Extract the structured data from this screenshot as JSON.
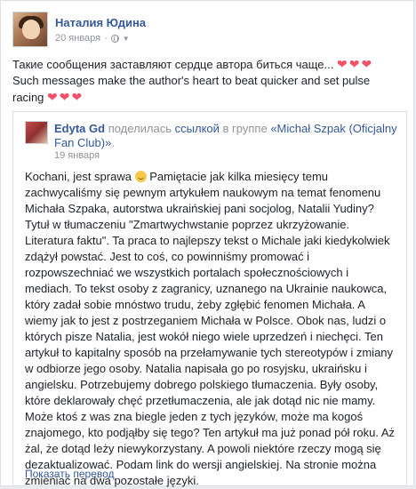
{
  "post": {
    "author": "Наталия Юдина",
    "date": "20 января",
    "text_ru": "Такие сообщения заставляют сердце автора биться чаще...",
    "text_en": "Such messages make the author's heart to beat quicker and set pulse racing",
    "hearts": "❤❤❤"
  },
  "shared": {
    "author": "Edyta Gd",
    "action": "поделилась",
    "link": "ссылкой",
    "in_group": "в группе",
    "group": "«Michał Szpak (Oficjalny Fan Club)»",
    "period": ".",
    "date": "19 января",
    "body_pre": "Kochani, jest sprawa ",
    "body_post": " Pamiętacie jak kilka miesięcy temu zachwycaliśmy się pewnym artykułem naukowym na temat fenomenu Michała Szpaka, autorstwa ukraińskiej pani socjolog, Natalii Yudiny? Tytuł w tłumaczeniu \"Zmartwychwstanie poprzez ukrzyżowanie. Literatura faktu\". Ta praca to najlepszy tekst o Michale jaki kiedykolwiek zdążył powstać. Jest to coś, co powinniśmy promować i rozpowszechniać we wszystkich portalach społecznościowych i mediach. To tekst osoby z zagranicy, uznanego na Ukrainie naukowca, który zadał sobie mnóstwo trudu, żeby zgłębić fenomen Michała. A wiemy jak to jest z postrzeganiem Michała w Polsce. Obok nas, ludzi o których pisze Natalia, jest wokół niego wiele uprzedzeń i niechęci. Ten artykuł to kapitalny sposób na przełamywanie tych stereotypów i zmiany w odbiorze jego osoby. Natalia napisała go po rosyjsku, ukraińsku i angielsku. Potrzebujemy dobrego polskiego tłumaczenia. Były osoby, które deklarowały chęć przetłumaczenia, ale jak dotąd nic nie mamy. Może ktoś z was zna biegle jeden z tych języków, może ma kogoś znajomego, kto podjąłby się tego? Ten artykuł ma już ponad pół roku. Aż żal, że dotąd leży niewykorzystany. A powoli niektóre rzeczy mogą się dezaktualizować. Podam link do wersji angielskiej. Na stronie można zmieniać na dwa pozostałe języki.",
    "translate_label": "Показать перевод"
  }
}
